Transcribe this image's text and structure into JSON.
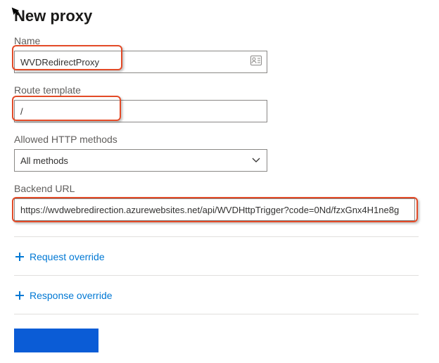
{
  "title": "New proxy",
  "fields": {
    "name": {
      "label": "Name",
      "value": "WVDRedirectProxy"
    },
    "route": {
      "label": "Route template",
      "value": "/"
    },
    "methods": {
      "label": "Allowed HTTP methods",
      "value": "All methods"
    },
    "backend": {
      "label": "Backend URL",
      "value": "https://wvdwebredirection.azurewebsites.net/api/WVDHttpTrigger?code=0Nd/fzxGnx4H1ne8g"
    }
  },
  "overrides": {
    "request": "Request override",
    "response": "Response override"
  },
  "highlight_color": "#e34a27",
  "accent_color": "#0078d4"
}
